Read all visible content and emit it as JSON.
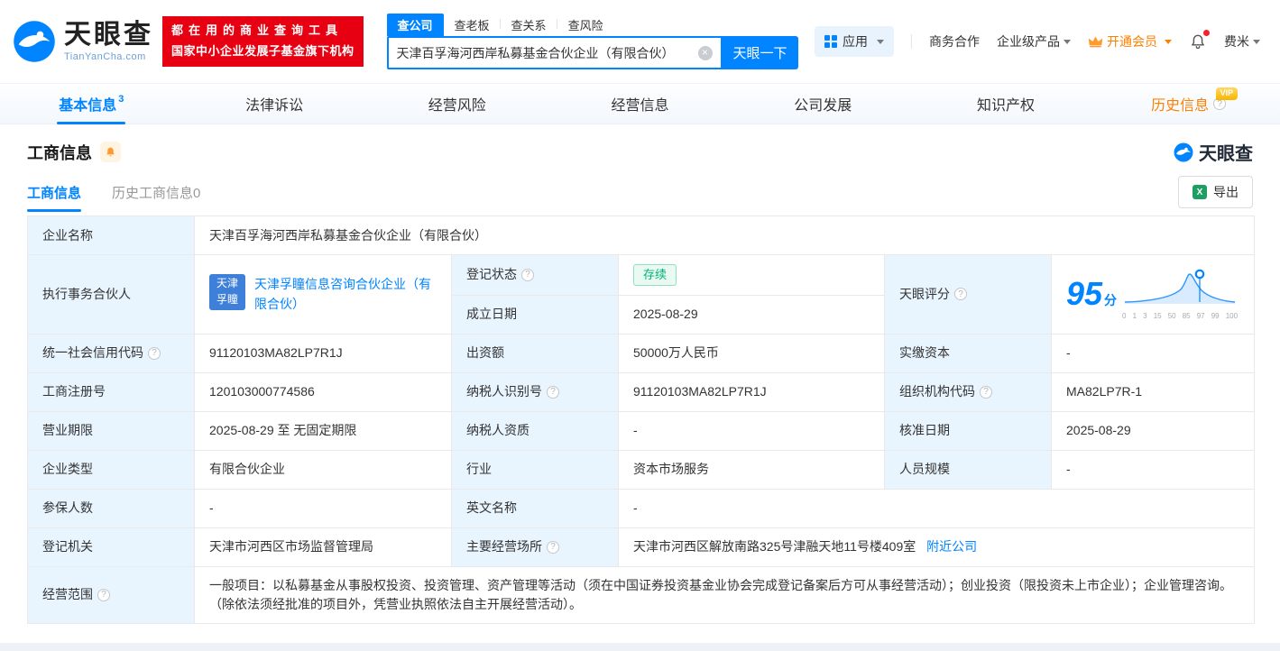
{
  "brand": {
    "name": "天眼查",
    "domain": "TianYanCha.com",
    "slogan_line1": "都在用的商业查询工具",
    "slogan_line2": "国家中小企业发展子基金旗下机构"
  },
  "search": {
    "tabs": [
      {
        "label": "查公司",
        "active": true
      },
      {
        "label": "查老板",
        "active": false
      },
      {
        "label": "查关系",
        "active": false
      },
      {
        "label": "查风险",
        "active": false
      }
    ],
    "value": "天津百孚海河西岸私募基金合伙企业（有限合伙）",
    "button": "天眼一下"
  },
  "header_menu": {
    "apps": "应用",
    "cooperation": "商务合作",
    "enterprise": "企业级产品",
    "vip": "开通会员",
    "user": "费米"
  },
  "nav_tabs": [
    {
      "label": "基本信息",
      "count": "3",
      "active": true
    },
    {
      "label": "法律诉讼"
    },
    {
      "label": "经营风险"
    },
    {
      "label": "经营信息"
    },
    {
      "label": "公司发展"
    },
    {
      "label": "知识产权"
    },
    {
      "label": "历史信息",
      "vip": true
    }
  ],
  "section": {
    "title": "工商信息",
    "watermark": "天眼查"
  },
  "subtabs": {
    "current": "工商信息",
    "history": "历史工商信息0",
    "export_label": "导出"
  },
  "info": {
    "company_name": {
      "label": "企业名称",
      "value": "天津百孚海河西岸私募基金合伙企业（有限合伙）"
    },
    "partner": {
      "label": "执行事务合伙人",
      "logo_line1": "天津",
      "logo_line2": "孚瞳",
      "link": "天津孚瞳信息咨询合伙企业（有限合伙）"
    },
    "reg_status": {
      "label": "登记状态",
      "value": "存续"
    },
    "establish_date": {
      "label": "成立日期",
      "value": "2025-08-29"
    },
    "score": {
      "label": "天眼评分",
      "value": "95",
      "unit": "分",
      "ticks": [
        "0",
        "1",
        "3",
        "15",
        "50",
        "85",
        "97",
        "99",
        "100"
      ]
    },
    "credit_code": {
      "label": "统一社会信用代码",
      "value": "91120103MA82LP7R1J"
    },
    "capital": {
      "label": "出资额",
      "value": "50000万人民币"
    },
    "paid_capital": {
      "label": "实缴资本",
      "value": "-"
    },
    "reg_number": {
      "label": "工商注册号",
      "value": "120103000774586"
    },
    "taxpayer_id": {
      "label": "纳税人识别号",
      "value": "91120103MA82LP7R1J"
    },
    "org_code": {
      "label": "组织机构代码",
      "value": "MA82LP7R-1"
    },
    "business_term": {
      "label": "营业期限",
      "value": "2025-08-29 至 无固定期限"
    },
    "taxpayer_quality": {
      "label": "纳税人资质",
      "value": "-"
    },
    "approval_date": {
      "label": "核准日期",
      "value": "2025-08-29"
    },
    "company_type": {
      "label": "企业类型",
      "value": "有限合伙企业"
    },
    "industry": {
      "label": "行业",
      "value": "资本市场服务"
    },
    "staff_size": {
      "label": "人员规模",
      "value": "-"
    },
    "insured_count": {
      "label": "参保人数",
      "value": "-"
    },
    "english_name": {
      "label": "英文名称",
      "value": "-"
    },
    "reg_authority": {
      "label": "登记机关",
      "value": "天津市河西区市场监督管理局"
    },
    "business_address": {
      "label": "主要经营场所",
      "value": "天津市河西区解放南路325号津融天地11号楼409室",
      "nearby_link": "附近公司"
    },
    "business_scope": {
      "label": "经营范围",
      "value": "一般项目：以私募基金从事股权投资、投资管理、资产管理等活动（须在中国证券投资基金业协会完成登记备案后方可从事经营活动）；创业投资（限投资未上市企业）；企业管理咨询。（除依法须经批准的项目外，凭营业执照依法自主开展经营活动）。"
    }
  },
  "icons": {
    "help": "?",
    "clear": "×",
    "excel": "X",
    "vip": "VIP"
  },
  "colors": {
    "accent": "#0084ff",
    "promo_red": "#e60012",
    "status_green": "#00b578",
    "vip_orange": "#ff8000",
    "label_bg": "#e8f4fe",
    "link_blue": "#0084ff"
  }
}
